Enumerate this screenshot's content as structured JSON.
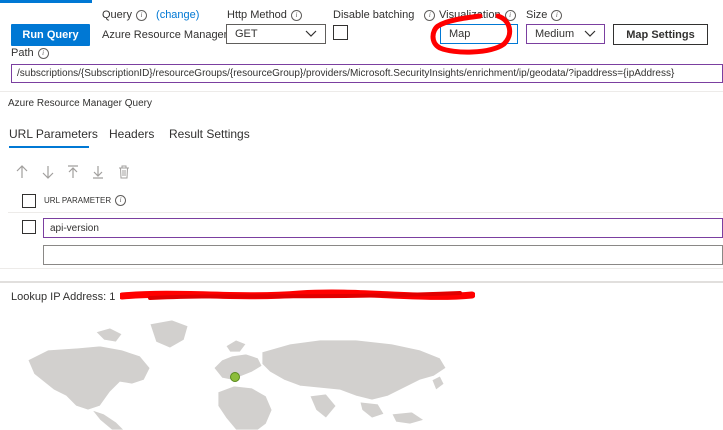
{
  "toolbar": {
    "run_query_label": "Run Query",
    "query_label": "Query",
    "change_link": "(change)",
    "query_type": "Azure Resource Manager",
    "http_method_label": "Http Method",
    "http_method_value": "GET",
    "disable_batching_label": "Disable batching",
    "visualization_label": "Visualization",
    "visualization_value": "Map",
    "size_label": "Size",
    "size_value": "Medium",
    "map_settings_label": "Map Settings"
  },
  "path": {
    "label": "Path",
    "value": "/subscriptions/{SubscriptionID}/resourceGroups/{resourceGroup}/providers/Microsoft.SecurityInsights/enrichment/ip/geodata/?ipaddress={ipAddress}"
  },
  "section_title": "Azure Resource Manager Query",
  "tabs": [
    {
      "label": "URL Parameters",
      "active": true
    },
    {
      "label": "Headers",
      "active": false
    },
    {
      "label": "Result Settings",
      "active": false
    }
  ],
  "params_toolbar": {
    "icons": [
      "arrow-up-icon",
      "arrow-down-icon",
      "move-to-top-icon",
      "move-to-bottom-icon",
      "delete-icon"
    ]
  },
  "params_table": {
    "column_header": "URL PARAMETER",
    "rows": [
      {
        "value": "api-version"
      },
      {
        "value": ""
      }
    ]
  },
  "lookup": {
    "label": "Lookup IP Address: 1",
    "redacted": true
  },
  "colors": {
    "accent": "#0078d4",
    "focus_border": "#7b3fa0",
    "annotation": "#ff0000",
    "map_land": "#d2d0ce",
    "map_marker": "#8cbd3a"
  }
}
